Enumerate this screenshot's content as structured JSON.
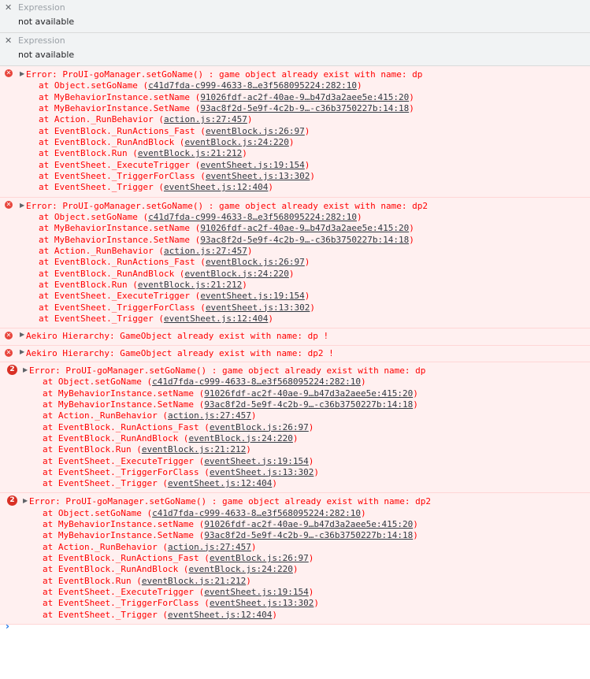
{
  "watch_expressions": [
    {
      "label": "Expression",
      "value": "not available"
    },
    {
      "label": "Expression",
      "value": "not available"
    }
  ],
  "messages": [
    {
      "type": "error",
      "count": "",
      "text": "Error: ProUI-goManager.setGoName() : game object already exist with name: dp",
      "frames": [
        {
          "fn": "at Object.setGoName",
          "loc": "c41d7fda-c999-4633-8…e3f568095224:282:10"
        },
        {
          "fn": "at MyBehaviorInstance.setName",
          "loc": "91026fdf-ac2f-40ae-9…b47d3a2aee5e:415:20"
        },
        {
          "fn": "at MyBehaviorInstance.SetName",
          "loc": "93ac8f2d-5e9f-4c2b-9…-c36b3750227b:14:18"
        },
        {
          "fn": "at Action._RunBehavior",
          "loc": "action.js:27:457"
        },
        {
          "fn": "at EventBlock._RunActions_Fast",
          "loc": "eventBlock.js:26:97"
        },
        {
          "fn": "at EventBlock._RunAndBlock",
          "loc": "eventBlock.js:24:220"
        },
        {
          "fn": "at EventBlock.Run",
          "loc": "eventBlock.js:21:212"
        },
        {
          "fn": "at EventSheet._ExecuteTrigger",
          "loc": "eventSheet.js:19:154"
        },
        {
          "fn": "at EventSheet._TriggerForClass",
          "loc": "eventSheet.js:13:302"
        },
        {
          "fn": "at EventSheet._Trigger",
          "loc": "eventSheet.js:12:404"
        }
      ]
    },
    {
      "type": "error",
      "count": "",
      "text": "Error: ProUI-goManager.setGoName() : game object already exist with name: dp2",
      "frames": [
        {
          "fn": "at Object.setGoName",
          "loc": "c41d7fda-c999-4633-8…e3f568095224:282:10"
        },
        {
          "fn": "at MyBehaviorInstance.setName",
          "loc": "91026fdf-ac2f-40ae-9…b47d3a2aee5e:415:20"
        },
        {
          "fn": "at MyBehaviorInstance.SetName",
          "loc": "93ac8f2d-5e9f-4c2b-9…-c36b3750227b:14:18"
        },
        {
          "fn": "at Action._RunBehavior",
          "loc": "action.js:27:457"
        },
        {
          "fn": "at EventBlock._RunActions_Fast",
          "loc": "eventBlock.js:26:97"
        },
        {
          "fn": "at EventBlock._RunAndBlock",
          "loc": "eventBlock.js:24:220"
        },
        {
          "fn": "at EventBlock.Run",
          "loc": "eventBlock.js:21:212"
        },
        {
          "fn": "at EventSheet._ExecuteTrigger",
          "loc": "eventSheet.js:19:154"
        },
        {
          "fn": "at EventSheet._TriggerForClass",
          "loc": "eventSheet.js:13:302"
        },
        {
          "fn": "at EventSheet._Trigger",
          "loc": "eventSheet.js:12:404"
        }
      ]
    },
    {
      "type": "simple",
      "text": "Aekiro Hierarchy: GameObject already exist with name: dp !"
    },
    {
      "type": "simple",
      "text": "Aekiro Hierarchy: GameObject already exist with name: dp2 !"
    },
    {
      "type": "error",
      "count": "2",
      "text": "Error: ProUI-goManager.setGoName() : game object already exist with name: dp",
      "frames": [
        {
          "fn": "at Object.setGoName",
          "loc": "c41d7fda-c999-4633-8…e3f568095224:282:10"
        },
        {
          "fn": "at MyBehaviorInstance.setName",
          "loc": "91026fdf-ac2f-40ae-9…b47d3a2aee5e:415:20"
        },
        {
          "fn": "at MyBehaviorInstance.SetName",
          "loc": "93ac8f2d-5e9f-4c2b-9…-c36b3750227b:14:18"
        },
        {
          "fn": "at Action._RunBehavior",
          "loc": "action.js:27:457"
        },
        {
          "fn": "at EventBlock._RunActions_Fast",
          "loc": "eventBlock.js:26:97"
        },
        {
          "fn": "at EventBlock._RunAndBlock",
          "loc": "eventBlock.js:24:220"
        },
        {
          "fn": "at EventBlock.Run",
          "loc": "eventBlock.js:21:212"
        },
        {
          "fn": "at EventSheet._ExecuteTrigger",
          "loc": "eventSheet.js:19:154"
        },
        {
          "fn": "at EventSheet._TriggerForClass",
          "loc": "eventSheet.js:13:302"
        },
        {
          "fn": "at EventSheet._Trigger",
          "loc": "eventSheet.js:12:404"
        }
      ]
    },
    {
      "type": "error",
      "count": "2",
      "text": "Error: ProUI-goManager.setGoName() : game object already exist with name: dp2",
      "frames": [
        {
          "fn": "at Object.setGoName",
          "loc": "c41d7fda-c999-4633-8…e3f568095224:282:10"
        },
        {
          "fn": "at MyBehaviorInstance.setName",
          "loc": "91026fdf-ac2f-40ae-9…b47d3a2aee5e:415:20"
        },
        {
          "fn": "at MyBehaviorInstance.SetName",
          "loc": "93ac8f2d-5e9f-4c2b-9…-c36b3750227b:14:18"
        },
        {
          "fn": "at Action._RunBehavior",
          "loc": "action.js:27:457"
        },
        {
          "fn": "at EventBlock._RunActions_Fast",
          "loc": "eventBlock.js:26:97"
        },
        {
          "fn": "at EventBlock._RunAndBlock",
          "loc": "eventBlock.js:24:220"
        },
        {
          "fn": "at EventBlock.Run",
          "loc": "eventBlock.js:21:212"
        },
        {
          "fn": "at EventSheet._ExecuteTrigger",
          "loc": "eventSheet.js:19:154"
        },
        {
          "fn": "at EventSheet._TriggerForClass",
          "loc": "eventSheet.js:13:302"
        },
        {
          "fn": "at EventSheet._Trigger",
          "loc": "eventSheet.js:12:404"
        }
      ]
    }
  ],
  "icons": {
    "close": "close-icon",
    "error": "error-icon",
    "expand": "expand-triangle-icon",
    "prompt": "prompt-chevron-icon"
  },
  "glyphs": {
    "close": "✕",
    "error": "✕",
    "expand": "▶",
    "prompt": "›"
  },
  "colors": {
    "error_text": "#ff0000",
    "error_bg": "#fff0f0",
    "badge": "#d93025",
    "prompt": "#1a73e8"
  }
}
